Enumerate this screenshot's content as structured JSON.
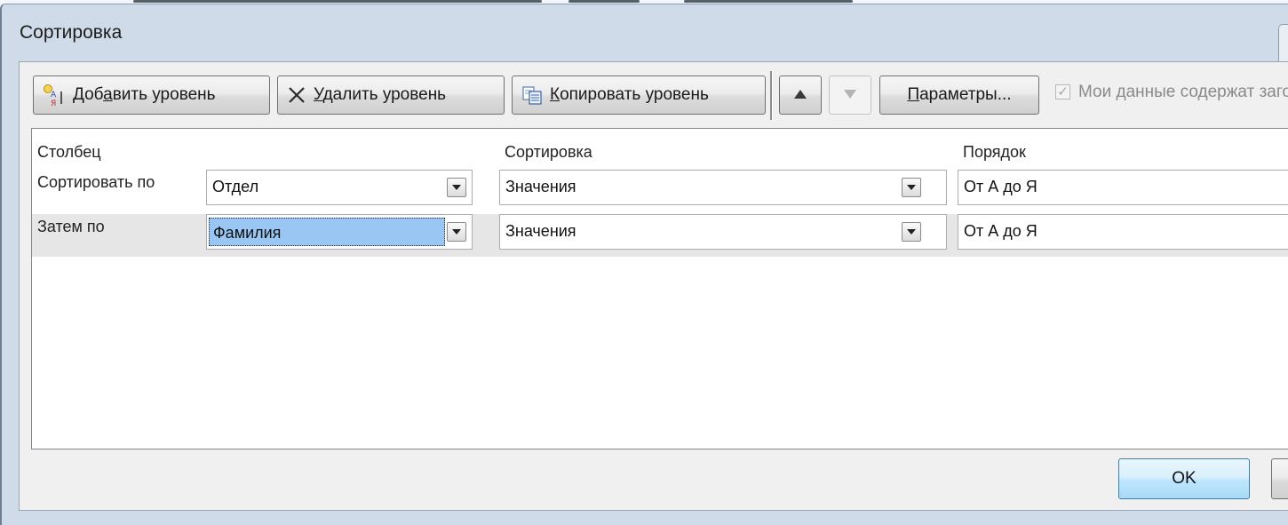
{
  "window": {
    "title": "Сортировка"
  },
  "toolbar": {
    "add_level": {
      "before": "Доб",
      "accel": "а",
      "after": "вить уровень"
    },
    "delete_level": {
      "accel": "У",
      "after": "далить уровень"
    },
    "copy_level": {
      "accel": "К",
      "after": "опировать уровень"
    },
    "options": {
      "accel": "П",
      "after": "араметры..."
    },
    "my_data_headers": {
      "label": "Мои данные содержат заголовки",
      "checked": true,
      "enabled": false
    }
  },
  "grid": {
    "headers": {
      "column": "Столбец",
      "sort_on": "Сортировка",
      "order": "Порядок"
    },
    "rows": [
      {
        "label": "Сортировать по",
        "column": "Отдел",
        "sort_on": "Значения",
        "order": "От А до Я",
        "selected": false
      },
      {
        "label": "Затем по",
        "column": "Фамилия",
        "sort_on": "Значения",
        "order": "От А до Я",
        "selected": true
      }
    ]
  },
  "footer": {
    "ok": "OK"
  },
  "icons": {
    "add_level": "sort-add-icon",
    "delete_level": "close-x-icon",
    "copy_level": "copy-icon",
    "move_up": "triangle-up-icon",
    "move_down": "triangle-down-icon",
    "dropdown": "chevron-down-icon"
  },
  "colors": {
    "frame": "#cfdbe8",
    "selection": "#99c6f2",
    "ok_button": "#bee6fd"
  }
}
